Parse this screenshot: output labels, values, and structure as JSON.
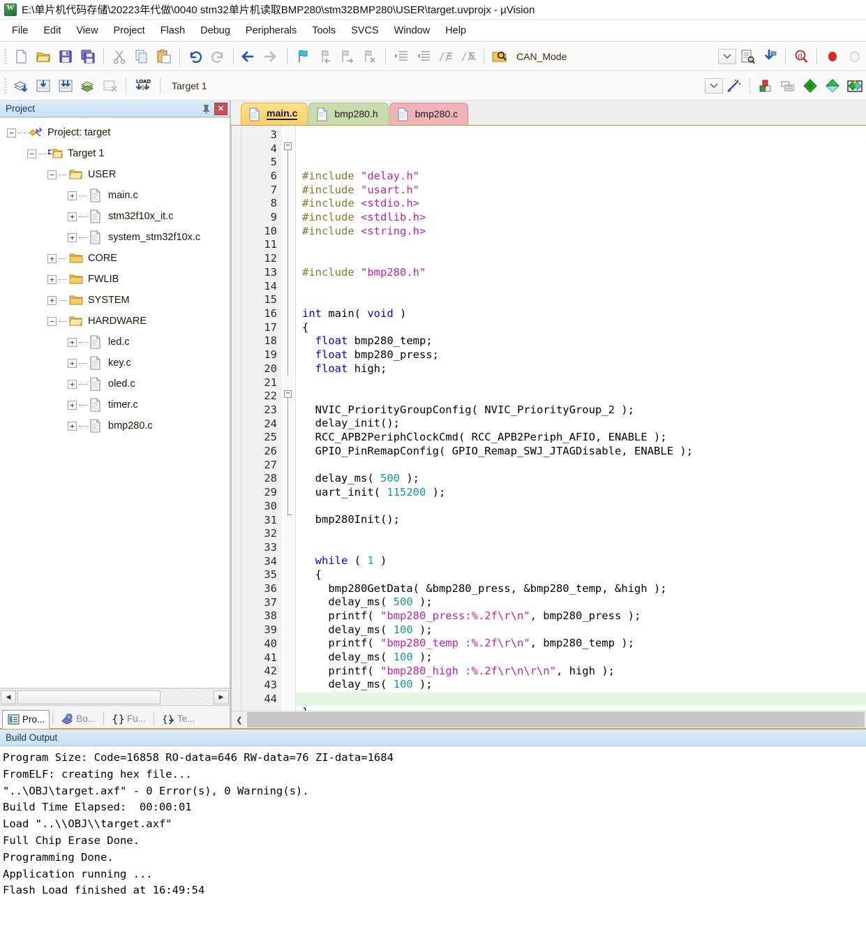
{
  "window": {
    "title": "E:\\单片机代码存储\\20223年代做\\0040 stm32单片机读取BMP280\\stm32BMP280\\USER\\target.uvprojx - µVision",
    "app_icon": "uvision-icon"
  },
  "menubar": {
    "items": [
      "File",
      "Edit",
      "View",
      "Project",
      "Flash",
      "Debug",
      "Peripherals",
      "Tools",
      "SVCS",
      "Window",
      "Help"
    ]
  },
  "toolbar_file": {
    "icons": [
      "new-file-icon",
      "open-file-icon",
      "save-icon",
      "save-all-icon",
      "cut-icon",
      "copy-icon",
      "paste-icon",
      "undo-icon",
      "redo-icon",
      "navigate-back-icon",
      "navigate-forward-icon",
      "bookmark-toggle-icon",
      "bookmark-prev-icon",
      "bookmark-next-icon",
      "bookmark-clear-icon",
      "indent-icon",
      "outdent-icon",
      "comment-icon",
      "uncomment-icon"
    ],
    "find_icon": "find-in-files-icon",
    "combo_value": "CAN_Mode",
    "combo_arrow_icon": "chevron-down-icon",
    "right_icons": [
      "configuration-wizard-icon",
      "insert-bookmark-icon",
      "zoom-find-icon",
      "stop-icon",
      "idle-icon"
    ]
  },
  "toolbar_build": {
    "icons": [
      "translate-icon",
      "build-icon",
      "rebuild-all-icon",
      "batch-build-icon",
      "stop-build-icon",
      "load-icon"
    ],
    "load_label": "LOAD",
    "target_value": "Target 1",
    "target_arrow_icon": "chevron-down-icon",
    "magic_wand_icon": "options-for-target-icon",
    "right_icons": [
      "manage-project-items-icon",
      "manage-multi-project-icon",
      "pack-installer-icon",
      "pack-manage-icon",
      "pack-select-icon"
    ]
  },
  "project_panel": {
    "header": "Project",
    "pin_icon": "pin-icon",
    "close_icon": "close-icon",
    "tree": [
      {
        "label": "Project: target",
        "depth": 0,
        "expander": "minus",
        "icon": "project-icon"
      },
      {
        "label": "Target 1",
        "depth": 1,
        "expander": "minus",
        "icon": "target-folder-icon"
      },
      {
        "label": "USER",
        "depth": 2,
        "expander": "minus",
        "icon": "folder-open-icon"
      },
      {
        "label": "main.c",
        "depth": 3,
        "expander": "plus",
        "icon": "c-file-icon"
      },
      {
        "label": "stm32f10x_it.c",
        "depth": 3,
        "expander": "plus",
        "icon": "c-file-icon"
      },
      {
        "label": "system_stm32f10x.c",
        "depth": 3,
        "expander": "plus",
        "icon": "c-file-icon"
      },
      {
        "label": "CORE",
        "depth": 2,
        "expander": "plus",
        "icon": "folder-closed-icon"
      },
      {
        "label": "FWLIB",
        "depth": 2,
        "expander": "plus",
        "icon": "folder-closed-icon"
      },
      {
        "label": "SYSTEM",
        "depth": 2,
        "expander": "plus",
        "icon": "folder-closed-icon"
      },
      {
        "label": "HARDWARE",
        "depth": 2,
        "expander": "minus",
        "icon": "folder-open-icon"
      },
      {
        "label": "led.c",
        "depth": 3,
        "expander": "plus",
        "icon": "c-file-icon"
      },
      {
        "label": "key.c",
        "depth": 3,
        "expander": "plus",
        "icon": "c-file-icon"
      },
      {
        "label": "oled.c",
        "depth": 3,
        "expander": "plus",
        "icon": "c-file-icon"
      },
      {
        "label": "timer.c",
        "depth": 3,
        "expander": "plus",
        "icon": "c-file-icon"
      },
      {
        "label": "bmp280.c",
        "depth": 3,
        "expander": "plus",
        "icon": "c-file-icon"
      }
    ],
    "hscroll": {
      "left_icon": "arrow-left-icon",
      "right_icon": "arrow-right-icon"
    },
    "tabs": [
      {
        "label": "Pro...",
        "icon": "project-window-icon",
        "active": true
      },
      {
        "label": "Bo...",
        "icon": "books-icon",
        "active": false
      },
      {
        "label": "Fu...",
        "icon": "functions-icon",
        "active": false
      },
      {
        "label": "Te...",
        "icon": "templates-icon",
        "active": false
      }
    ]
  },
  "editor": {
    "tabs": [
      {
        "label": "main.c",
        "icon": "c-file-icon",
        "active": true,
        "color": "#f9d06a"
      },
      {
        "label": "bmp280.h",
        "icon": "h-file-icon",
        "active": false,
        "color": "#c9dcae"
      },
      {
        "label": "bmp280.c",
        "icon": "c-file-icon",
        "active": false,
        "color": "#f0b3b7"
      }
    ],
    "first_line": 3,
    "last_line": 44,
    "current_line": 44,
    "scroll_left_icon": "chevron-left-icon",
    "lines": [
      {
        "n": 3,
        "tokens": [
          {
            "t": "#include ",
            "c": "pre"
          },
          {
            "t": "\"delay.h\"",
            "c": "str"
          }
        ]
      },
      {
        "n": 4,
        "tokens": [
          {
            "t": "#include ",
            "c": "pre"
          },
          {
            "t": "\"usart.h\"",
            "c": "str"
          }
        ]
      },
      {
        "n": 5,
        "tokens": [
          {
            "t": "#include ",
            "c": "pre"
          },
          {
            "t": "<stdio.h>",
            "c": "str"
          }
        ]
      },
      {
        "n": 6,
        "tokens": [
          {
            "t": "#include ",
            "c": "pre"
          },
          {
            "t": "<stdlib.h>",
            "c": "str"
          }
        ]
      },
      {
        "n": 7,
        "tokens": [
          {
            "t": "#include ",
            "c": "pre"
          },
          {
            "t": "<string.h>",
            "c": "str"
          }
        ]
      },
      {
        "n": 8,
        "tokens": []
      },
      {
        "n": 9,
        "tokens": []
      },
      {
        "n": 10,
        "tokens": [
          {
            "t": "#include ",
            "c": "pre"
          },
          {
            "t": "\"bmp280.h\"",
            "c": "str"
          }
        ]
      },
      {
        "n": 11,
        "tokens": []
      },
      {
        "n": 12,
        "tokens": []
      },
      {
        "n": 13,
        "tokens": [
          {
            "t": "int",
            "c": "kw"
          },
          {
            "t": " main( ",
            "c": ""
          },
          {
            "t": "void",
            "c": "kw"
          },
          {
            "t": " )",
            "c": ""
          }
        ]
      },
      {
        "n": 14,
        "tokens": [
          {
            "t": "{",
            "c": ""
          }
        ]
      },
      {
        "n": 15,
        "tokens": [
          {
            "t": "  ",
            "c": ""
          },
          {
            "t": "float",
            "c": "kw"
          },
          {
            "t": " bmp280_temp;",
            "c": ""
          }
        ]
      },
      {
        "n": 16,
        "tokens": [
          {
            "t": "  ",
            "c": ""
          },
          {
            "t": "float",
            "c": "kw"
          },
          {
            "t": " bmp280_press;",
            "c": ""
          }
        ]
      },
      {
        "n": 17,
        "tokens": [
          {
            "t": "  ",
            "c": ""
          },
          {
            "t": "float",
            "c": "kw"
          },
          {
            "t": " high;",
            "c": ""
          }
        ]
      },
      {
        "n": 18,
        "tokens": []
      },
      {
        "n": 19,
        "tokens": []
      },
      {
        "n": 20,
        "tokens": [
          {
            "t": "  NVIC_PriorityGroupConfig( NVIC_PriorityGroup_2 );",
            "c": ""
          }
        ]
      },
      {
        "n": 21,
        "tokens": [
          {
            "t": "  delay_init();",
            "c": ""
          }
        ]
      },
      {
        "n": 22,
        "tokens": [
          {
            "t": "  RCC_APB2PeriphClockCmd( RCC_APB2Periph_AFIO, ENABLE );",
            "c": ""
          }
        ]
      },
      {
        "n": 23,
        "tokens": [
          {
            "t": "  GPIO_PinRemapConfig( GPIO_Remap_SWJ_JTAGDisable, ENABLE );",
            "c": ""
          }
        ]
      },
      {
        "n": 24,
        "tokens": []
      },
      {
        "n": 25,
        "tokens": [
          {
            "t": "  delay_ms( ",
            "c": ""
          },
          {
            "t": "500",
            "c": "num"
          },
          {
            "t": " );",
            "c": ""
          }
        ]
      },
      {
        "n": 26,
        "tokens": [
          {
            "t": "  uart_init( ",
            "c": ""
          },
          {
            "t": "115200",
            "c": "num"
          },
          {
            "t": " );",
            "c": ""
          }
        ]
      },
      {
        "n": 27,
        "tokens": []
      },
      {
        "n": 28,
        "tokens": [
          {
            "t": "  bmp280Init();",
            "c": ""
          }
        ]
      },
      {
        "n": 29,
        "tokens": []
      },
      {
        "n": 30,
        "tokens": []
      },
      {
        "n": 31,
        "tokens": [
          {
            "t": "  ",
            "c": ""
          },
          {
            "t": "while",
            "c": "kw"
          },
          {
            "t": " ( ",
            "c": ""
          },
          {
            "t": "1",
            "c": "num"
          },
          {
            "t": " )",
            "c": ""
          }
        ]
      },
      {
        "n": 32,
        "tokens": [
          {
            "t": "  {",
            "c": ""
          }
        ]
      },
      {
        "n": 33,
        "tokens": [
          {
            "t": "    bmp280GetData( &bmp280_press, &bmp280_temp, &high );",
            "c": ""
          }
        ]
      },
      {
        "n": 34,
        "tokens": [
          {
            "t": "    delay_ms( ",
            "c": ""
          },
          {
            "t": "500",
            "c": "num"
          },
          {
            "t": " );",
            "c": ""
          }
        ]
      },
      {
        "n": 35,
        "tokens": [
          {
            "t": "    printf( ",
            "c": ""
          },
          {
            "t": "\"bmp280_press:",
            "c": "str"
          },
          {
            "t": "%.2f",
            "c": "fmt"
          },
          {
            "t": "\\r\\n\"",
            "c": "str"
          },
          {
            "t": ", bmp280_press );",
            "c": ""
          }
        ]
      },
      {
        "n": 36,
        "tokens": [
          {
            "t": "    delay_ms( ",
            "c": ""
          },
          {
            "t": "100",
            "c": "num"
          },
          {
            "t": " );",
            "c": ""
          }
        ]
      },
      {
        "n": 37,
        "tokens": [
          {
            "t": "    printf( ",
            "c": ""
          },
          {
            "t": "\"bmp280_temp :",
            "c": "str"
          },
          {
            "t": "%.2f",
            "c": "fmt"
          },
          {
            "t": "\\r\\n\"",
            "c": "str"
          },
          {
            "t": ", bmp280_temp );",
            "c": ""
          }
        ]
      },
      {
        "n": 38,
        "tokens": [
          {
            "t": "    delay_ms( ",
            "c": ""
          },
          {
            "t": "100",
            "c": "num"
          },
          {
            "t": " );",
            "c": ""
          }
        ]
      },
      {
        "n": 39,
        "tokens": [
          {
            "t": "    printf( ",
            "c": ""
          },
          {
            "t": "\"bmp280_high :",
            "c": "str"
          },
          {
            "t": "%.2f",
            "c": "fmt"
          },
          {
            "t": "\\r\\n\\r\\n\"",
            "c": "str"
          },
          {
            "t": ", high );",
            "c": ""
          }
        ]
      },
      {
        "n": 40,
        "tokens": [
          {
            "t": "    delay_ms( ",
            "c": ""
          },
          {
            "t": "100",
            "c": "num"
          },
          {
            "t": " );",
            "c": ""
          }
        ]
      },
      {
        "n": 41,
        "tokens": [
          {
            "t": "  }",
            "c": ""
          }
        ]
      },
      {
        "n": 42,
        "tokens": [
          {
            "t": "}",
            "c": ""
          }
        ]
      },
      {
        "n": 43,
        "tokens": []
      },
      {
        "n": 44,
        "tokens": []
      }
    ]
  },
  "build_output": {
    "header": "Build Output",
    "lines": [
      "Program Size: Code=16858 RO-data=646 RW-data=76 ZI-data=1684",
      "FromELF: creating hex file...",
      "\"..\\OBJ\\target.axf\" - 0 Error(s), 0 Warning(s).",
      "Build Time Elapsed:  00:00:01",
      "Load \"..\\\\OBJ\\\\target.axf\"",
      "Full Chip Erase Done.",
      "Programming Done.",
      "Application running ...",
      "Flash Load finished at 16:49:54"
    ]
  }
}
